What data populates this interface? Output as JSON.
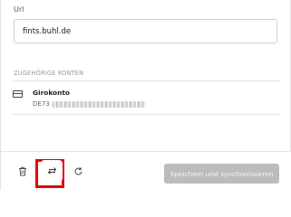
{
  "form": {
    "url_label": "Url",
    "url_value": "fints.buhl.de"
  },
  "accounts": {
    "section_title": "ZUGEHÖRIGE KONTEN",
    "items": [
      {
        "name": "Girokonto",
        "iban_prefix": "DE73",
        "icon": "bank-card-icon"
      }
    ]
  },
  "footer": {
    "delete_icon": "trash-icon",
    "swap_icon": "swap-arrows-icon",
    "refresh_icon": "refresh-icon",
    "save_label": "Speichern und synchronisieren"
  },
  "colors": {
    "highlight": "#e3000f",
    "save_button_bg": "#bcbcbc"
  }
}
